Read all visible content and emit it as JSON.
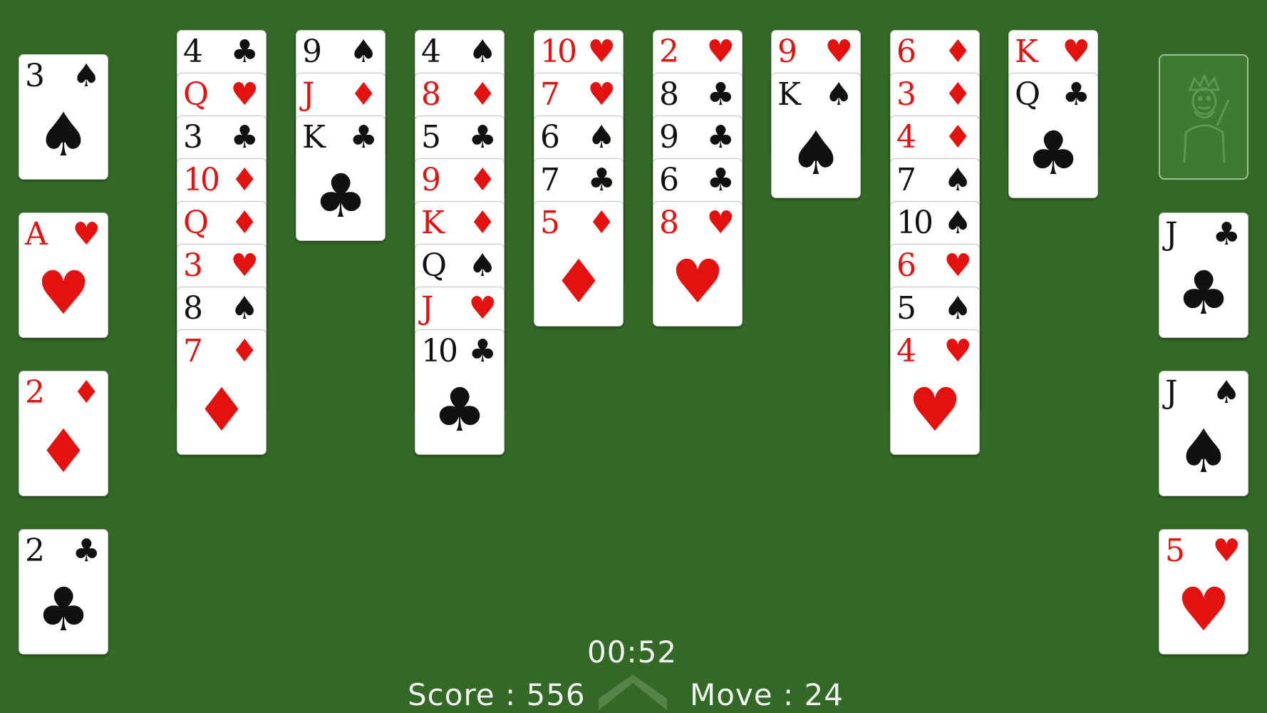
{
  "colors": {
    "felt": "#336827",
    "red_suit": "#e3110f",
    "black_suit": "#111111",
    "card_face": "#ffffff"
  },
  "left_column": [
    {
      "rank": "3",
      "suit": "spades",
      "symbol": "♠"
    },
    {
      "rank": "A",
      "suit": "hearts",
      "symbol": "♥"
    },
    {
      "rank": "2",
      "suit": "diamonds",
      "symbol": "♦"
    },
    {
      "rank": "2",
      "suit": "clubs",
      "symbol": "♣"
    }
  ],
  "tableau": [
    [
      {
        "rank": "4",
        "suit": "clubs",
        "symbol": "♣"
      },
      {
        "rank": "Q",
        "suit": "hearts",
        "symbol": "♥"
      },
      {
        "rank": "3",
        "suit": "clubs",
        "symbol": "♣"
      },
      {
        "rank": "10",
        "suit": "diamonds",
        "symbol": "♦"
      },
      {
        "rank": "Q",
        "suit": "diamonds",
        "symbol": "♦"
      },
      {
        "rank": "3",
        "suit": "hearts",
        "symbol": "♥"
      },
      {
        "rank": "8",
        "suit": "spades",
        "symbol": "♠"
      },
      {
        "rank": "7",
        "suit": "diamonds",
        "symbol": "♦"
      }
    ],
    [
      {
        "rank": "9",
        "suit": "spades",
        "symbol": "♠"
      },
      {
        "rank": "J",
        "suit": "diamonds",
        "symbol": "♦"
      },
      {
        "rank": "K",
        "suit": "clubs",
        "symbol": "♣"
      }
    ],
    [
      {
        "rank": "4",
        "suit": "spades",
        "symbol": "♠"
      },
      {
        "rank": "8",
        "suit": "diamonds",
        "symbol": "♦"
      },
      {
        "rank": "5",
        "suit": "clubs",
        "symbol": "♣"
      },
      {
        "rank": "9",
        "suit": "diamonds",
        "symbol": "♦"
      },
      {
        "rank": "K",
        "suit": "diamonds",
        "symbol": "♦"
      },
      {
        "rank": "Q",
        "suit": "spades",
        "symbol": "♠"
      },
      {
        "rank": "J",
        "suit": "hearts",
        "symbol": "♥"
      },
      {
        "rank": "10",
        "suit": "clubs",
        "symbol": "♣"
      }
    ],
    [
      {
        "rank": "10",
        "suit": "hearts",
        "symbol": "♥"
      },
      {
        "rank": "7",
        "suit": "hearts",
        "symbol": "♥"
      },
      {
        "rank": "6",
        "suit": "spades",
        "symbol": "♠"
      },
      {
        "rank": "7",
        "suit": "clubs",
        "symbol": "♣"
      },
      {
        "rank": "5",
        "suit": "diamonds",
        "symbol": "♦"
      }
    ],
    [
      {
        "rank": "2",
        "suit": "hearts",
        "symbol": "♥"
      },
      {
        "rank": "8",
        "suit": "clubs",
        "symbol": "♣"
      },
      {
        "rank": "9",
        "suit": "clubs",
        "symbol": "♣"
      },
      {
        "rank": "6",
        "suit": "clubs",
        "symbol": "♣"
      },
      {
        "rank": "8",
        "suit": "hearts",
        "symbol": "♥"
      }
    ],
    [
      {
        "rank": "9",
        "suit": "hearts",
        "symbol": "♥"
      },
      {
        "rank": "K",
        "suit": "spades",
        "symbol": "♠"
      }
    ],
    [
      {
        "rank": "6",
        "suit": "diamonds",
        "symbol": "♦"
      },
      {
        "rank": "3",
        "suit": "diamonds",
        "symbol": "♦"
      },
      {
        "rank": "4",
        "suit": "diamonds",
        "symbol": "♦"
      },
      {
        "rank": "7",
        "suit": "spades",
        "symbol": "♠"
      },
      {
        "rank": "10",
        "suit": "spades",
        "symbol": "♠"
      },
      {
        "rank": "6",
        "suit": "hearts",
        "symbol": "♥"
      },
      {
        "rank": "5",
        "suit": "spades",
        "symbol": "♠"
      },
      {
        "rank": "4",
        "suit": "hearts",
        "symbol": "♥"
      }
    ],
    [
      {
        "rank": "K",
        "suit": "hearts",
        "symbol": "♥"
      },
      {
        "rank": "Q",
        "suit": "clubs",
        "symbol": "♣"
      }
    ]
  ],
  "right_column": {
    "empty_slot_icon": "king-silhouette-icon",
    "cards": [
      {
        "rank": "J",
        "suit": "clubs",
        "symbol": "♣"
      },
      {
        "rank": "J",
        "suit": "spades",
        "symbol": "♠"
      },
      {
        "rank": "5",
        "suit": "hearts",
        "symbol": "♥"
      }
    ]
  },
  "status": {
    "timer": "00:52",
    "score": "Score : 556",
    "moves": "Move : 24"
  }
}
